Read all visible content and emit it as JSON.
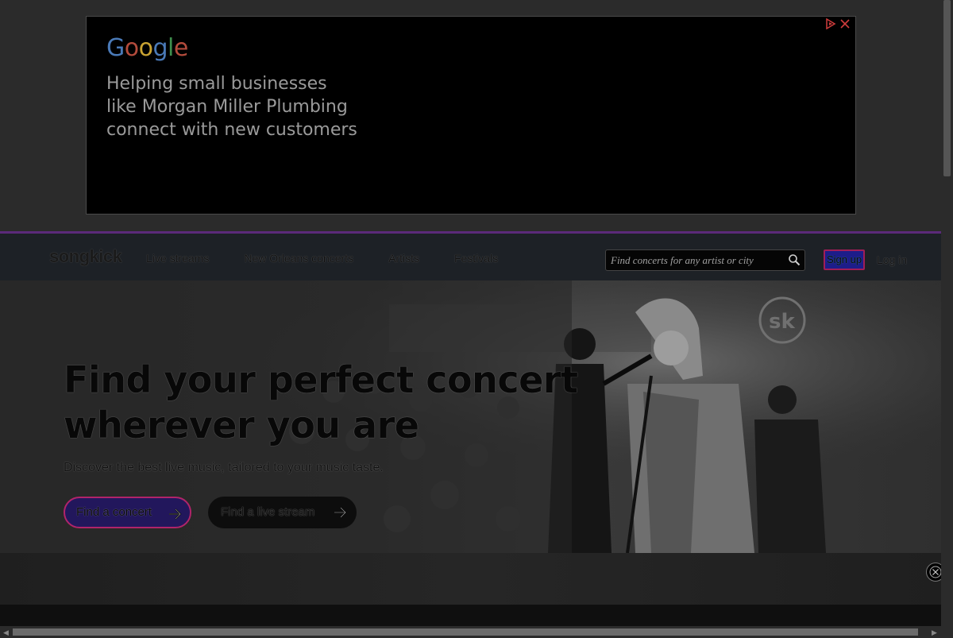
{
  "ad": {
    "logo_letters": [
      "G",
      "o",
      "o",
      "g",
      "l",
      "e"
    ],
    "lines": [
      "Helping small businesses",
      "like Morgan Miller Plumbing",
      "connect with new customers"
    ]
  },
  "header": {
    "logo": "songkick",
    "nav": [
      "Live streams",
      "New Orleans concerts",
      "Artists",
      "Festivals"
    ],
    "search_placeholder": "Find concerts for any artist or city",
    "signup": "Sign up",
    "login": "Log in"
  },
  "hero": {
    "title_lines": [
      "Find your perfect concert",
      "wherever you are"
    ],
    "subtitle": "Discover the best live music, tailored to your music taste.",
    "btn_concert": "Find a concert",
    "btn_stream": "Find a live stream"
  },
  "colors": {
    "header_border": "#5b2a7a",
    "signup_bg": "#1d1d8a",
    "signup_border": "#a01e58",
    "concert_btn_border": "#b0246a"
  }
}
